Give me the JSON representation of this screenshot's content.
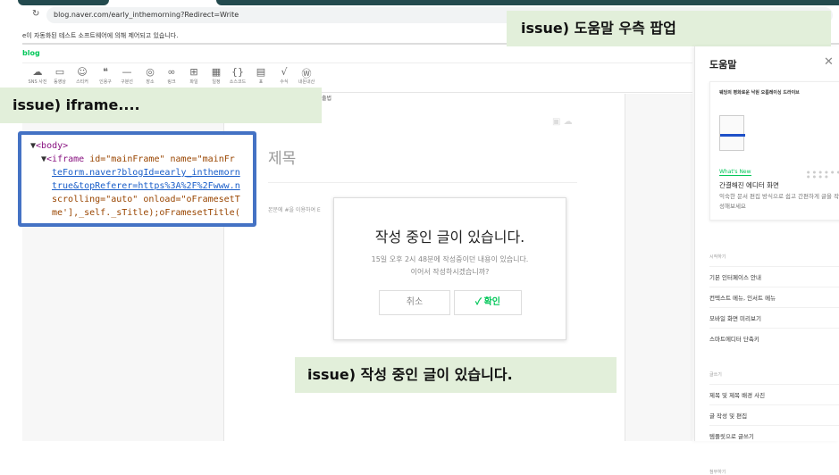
{
  "browser": {
    "url": "blog.naver.com/early_inthemorning?Redirect=Write",
    "info_bar": "e이 자동화된 테스트 소프트웨어에 의해 제어되고 있습니다.",
    "reload_icon": "↻"
  },
  "app": {
    "logo": "blog"
  },
  "toolbar": [
    {
      "icon": "☁",
      "label": "SNS 사진"
    },
    {
      "icon": "▭",
      "label": "동영상"
    },
    {
      "icon": "☺",
      "label": "스티커"
    },
    {
      "icon": "❝",
      "label": "인용구"
    },
    {
      "icon": "—",
      "label": "구분선"
    },
    {
      "icon": "◎",
      "label": "장소"
    },
    {
      "icon": "∞",
      "label": "링크"
    },
    {
      "icon": "⊞",
      "label": "파일"
    },
    {
      "icon": "▦",
      "label": "일정"
    },
    {
      "icon": "{}",
      "label": "소스코드"
    },
    {
      "icon": "▤",
      "label": "표"
    },
    {
      "icon": "√",
      "label": "수식"
    },
    {
      "icon": "Ⓦ",
      "label": "내돈내산"
    }
  ],
  "editor": {
    "subtab": "출법",
    "title_placeholder": "제목",
    "body_placeholder": "본문에 #을 이용하여 E",
    "side_icons": "▣ ☁"
  },
  "dialog": {
    "title": "작성 중인 글이 있습니다.",
    "message_line1": "15일 오후 2시 48분에 작성중이던 내용이 있습니다.",
    "message_line2": "이어서 작성하시겠습니까?",
    "cancel": "취소",
    "confirm": "확인",
    "confirm_icon": "✓"
  },
  "devtools": {
    "line1": "<body>",
    "line2_tag": "<iframe",
    "line2_attrs": " id=\"mainFrame\" name=\"mainFr",
    "line3": "teForm.naver?blogId=early_inthemorn",
    "line4": "true&topReferer=https%3A%2F%2Fwww.n",
    "line5": "scrolling=\"auto\" onload=\"oFramesetT",
    "line6": "me'],_self._sTitle);oFramesetTitle("
  },
  "callouts": {
    "iframe": "issue) iframe....",
    "help_popup": "issue) 도움말 우측 팝업",
    "draft": "issue) 작성 중인 글이 있습니다."
  },
  "help_panel": {
    "title": "도움말",
    "close": "✕",
    "card": {
      "headline": "웨딩의 평화로운 낙원 오름레이싱 드라이브",
      "whats_new": "What's New",
      "dots": "● ● ● ● ● ● ● ● ● ●",
      "heading": "간결해진 에디터 화면",
      "desc": "익숙한 문서 편집 방식으로 쉽고 간편하게 글을 작성해보세요"
    },
    "sections": [
      {
        "title": "시작하기",
        "items": [
          "기본 인터페이스 안내",
          "컨텍스트 메뉴, 인서트 메뉴",
          "모바일 화면 미리보기",
          "스마트에디터 단축키"
        ]
      },
      {
        "title": "글쓰기",
        "items": [
          "제목 및 제목 배경 사진",
          "글 작성 및 편집",
          "템플릿으로 글쓰기"
        ]
      },
      {
        "title": "첨부하기",
        "items": []
      }
    ]
  }
}
